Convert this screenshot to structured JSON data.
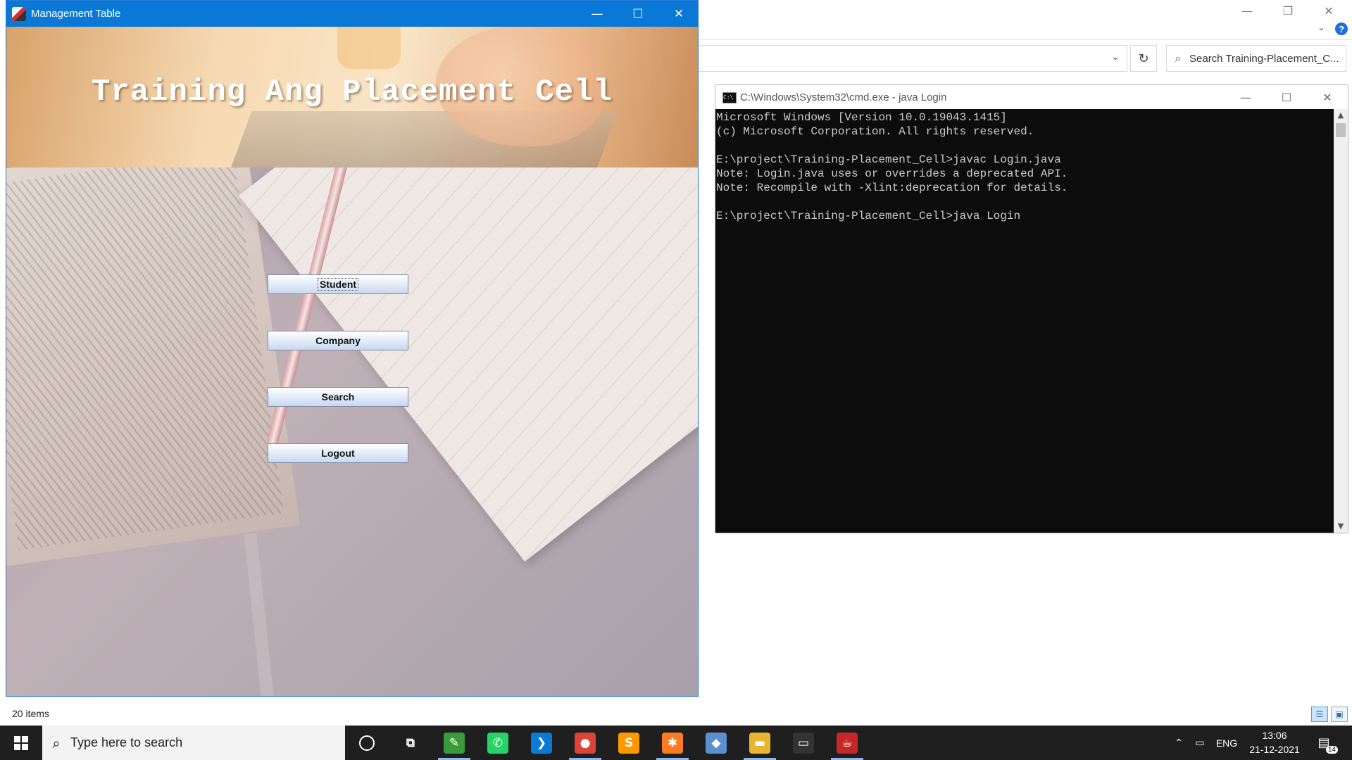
{
  "explorer": {
    "search_placeholder": "Search Training-Placement_C...",
    "status_count": "20 items",
    "controls": {
      "minimize": "—",
      "restore": "❐",
      "close": "✕",
      "expand": "⌄",
      "help": "?"
    },
    "address_dropdown": "⌄",
    "refresh": "↻",
    "search_icon": "⌕",
    "view_details": "☰",
    "view_large": "▣"
  },
  "java_window": {
    "title": "Management Table",
    "controls": {
      "minimize": "—",
      "maximize": "☐",
      "close": "✕"
    },
    "banner_title": "Training Ang Placement Cell",
    "buttons": [
      {
        "label": "Student",
        "focused": true
      },
      {
        "label": "Company",
        "focused": false
      },
      {
        "label": "Search",
        "focused": false
      },
      {
        "label": "Logout",
        "focused": false
      }
    ]
  },
  "cmd_window": {
    "title": "C:\\Windows\\System32\\cmd.exe - java  Login",
    "icon_text": "C:\\",
    "controls": {
      "minimize": "—",
      "maximize": "☐",
      "close": "✕"
    },
    "scroll_up": "▲",
    "scroll_down": "▼",
    "lines": [
      "Microsoft Windows [Version 10.0.19043.1415]",
      "(c) Microsoft Corporation. All rights reserved.",
      "",
      "E:\\project\\Training-Placement_Cell>javac Login.java",
      "Note: Login.java uses or overrides a deprecated API.",
      "Note: Recompile with -Xlint:deprecation for details.",
      "",
      "E:\\project\\Training-Placement_Cell>java Login"
    ]
  },
  "taskbar": {
    "search_placeholder": "Type here to search",
    "search_icon": "⌕",
    "apps": [
      {
        "name": "cortana",
        "glyph": "",
        "color": ""
      },
      {
        "name": "task-view",
        "glyph": "⧉",
        "color": "#1f1f1f"
      },
      {
        "name": "editor",
        "glyph": "✎",
        "color": "#3a9b3a"
      },
      {
        "name": "whatsapp",
        "glyph": "✆",
        "color": "#25d366"
      },
      {
        "name": "vscode",
        "glyph": "❯",
        "color": "#0a7ad4"
      },
      {
        "name": "chrome",
        "glyph": "●",
        "color": "#db4437"
      },
      {
        "name": "sublime",
        "glyph": "S",
        "color": "#ff9800"
      },
      {
        "name": "xampp",
        "glyph": "✱",
        "color": "#fb7a24"
      },
      {
        "name": "virtualbox",
        "glyph": "◆",
        "color": "#5a8fd0"
      },
      {
        "name": "file-explorer",
        "glyph": "▬",
        "color": "#e8b533"
      },
      {
        "name": "terminal",
        "glyph": "▭",
        "color": "#333333"
      },
      {
        "name": "java",
        "glyph": "☕",
        "color": "#c62828"
      }
    ],
    "tray": {
      "chevron": "⌃",
      "battery": "▭",
      "language": "ENG",
      "time": "13:06",
      "date": "21-12-2021",
      "notifications_icon": "▤",
      "notifications_count": "14"
    }
  }
}
